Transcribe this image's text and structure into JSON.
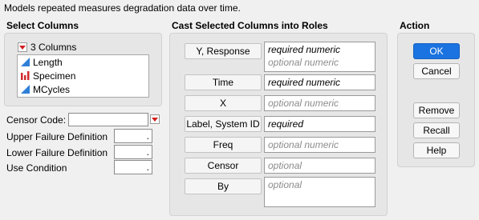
{
  "description": "Models repeated measures degradation data over time.",
  "select_columns": {
    "title": "Select Columns",
    "count_label": "3 Columns",
    "columns": [
      {
        "label": "Length",
        "icon": "continuous-icon"
      },
      {
        "label": "Specimen",
        "icon": "nominal-icon"
      },
      {
        "label": "MCycles",
        "icon": "continuous-icon"
      }
    ]
  },
  "options": {
    "censor_code_label": "Censor Code:",
    "censor_code_value": "",
    "upper_failure_label": "Upper Failure Definition",
    "upper_failure_value": ".",
    "lower_failure_label": "Lower Failure Definition",
    "lower_failure_value": ".",
    "use_condition_label": "Use Condition",
    "use_condition_value": "."
  },
  "roles": {
    "title": "Cast Selected Columns into Roles",
    "items": [
      {
        "button": "Y, Response",
        "lines": [
          "required numeric",
          "optional numeric"
        ]
      },
      {
        "button": "Time",
        "lines": [
          "required numeric"
        ]
      },
      {
        "button": "X",
        "lines": [
          "optional numeric"
        ]
      },
      {
        "button": "Label, System ID",
        "lines": [
          "required"
        ]
      },
      {
        "button": "Freq",
        "lines": [
          "optional numeric"
        ]
      },
      {
        "button": "Censor",
        "lines": [
          "optional"
        ]
      },
      {
        "button": "By",
        "lines": [
          "optional"
        ]
      }
    ]
  },
  "action": {
    "title": "Action",
    "ok": "OK",
    "cancel": "Cancel",
    "remove": "Remove",
    "recall": "Recall",
    "help": "Help"
  },
  "colors": {
    "accent": "#1a73e0",
    "continuous_icon": "#2f7fd8",
    "nominal_icon": "#d02b2b"
  }
}
